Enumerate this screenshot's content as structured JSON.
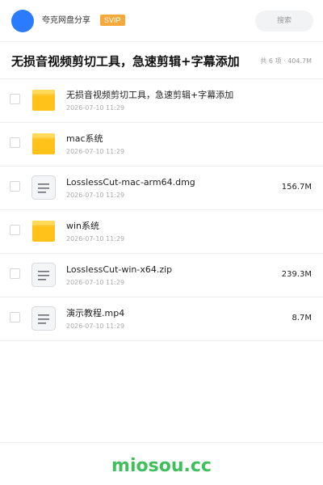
{
  "header": {
    "site_name": "夸克网盘分享",
    "badge": "SVIP",
    "search_label": "搜索"
  },
  "title_bar": {
    "title": "无损音视频剪切工具，急速剪辑+字幕添加",
    "summary": "共 6 项 · 404.7M"
  },
  "files": [
    {
      "type": "folder",
      "icon": "folder-icon",
      "name": "无损音视频剪切工具，急速剪辑+字幕添加",
      "date": "2026-07-10 11:29",
      "size": ""
    },
    {
      "type": "folder",
      "icon": "folder-icon",
      "name": "mac系统",
      "date": "2026-07-10 11:29",
      "size": ""
    },
    {
      "type": "file",
      "icon": "file-icon",
      "name": "LosslessCut-mac-arm64.dmg",
      "date": "2026-07-10 11:29",
      "size": "156.7M"
    },
    {
      "type": "folder",
      "icon": "folder-icon",
      "name": "win系统",
      "date": "2026-07-10 11:29",
      "size": ""
    },
    {
      "type": "file",
      "icon": "file-icon",
      "name": "LosslessCut-win-x64.zip",
      "date": "2026-07-10 11:29",
      "size": "239.3M"
    },
    {
      "type": "file",
      "icon": "file-icon",
      "name": "演示教程.mp4",
      "date": "2026-07-10 11:29",
      "size": "8.7M"
    }
  ],
  "footer": {
    "brand": "miosou.cc"
  },
  "colors": {
    "avatar": "#2b7bff",
    "badge": "#f7a83b",
    "folder": "#ffc21a",
    "brand": "#3fbf5b"
  }
}
